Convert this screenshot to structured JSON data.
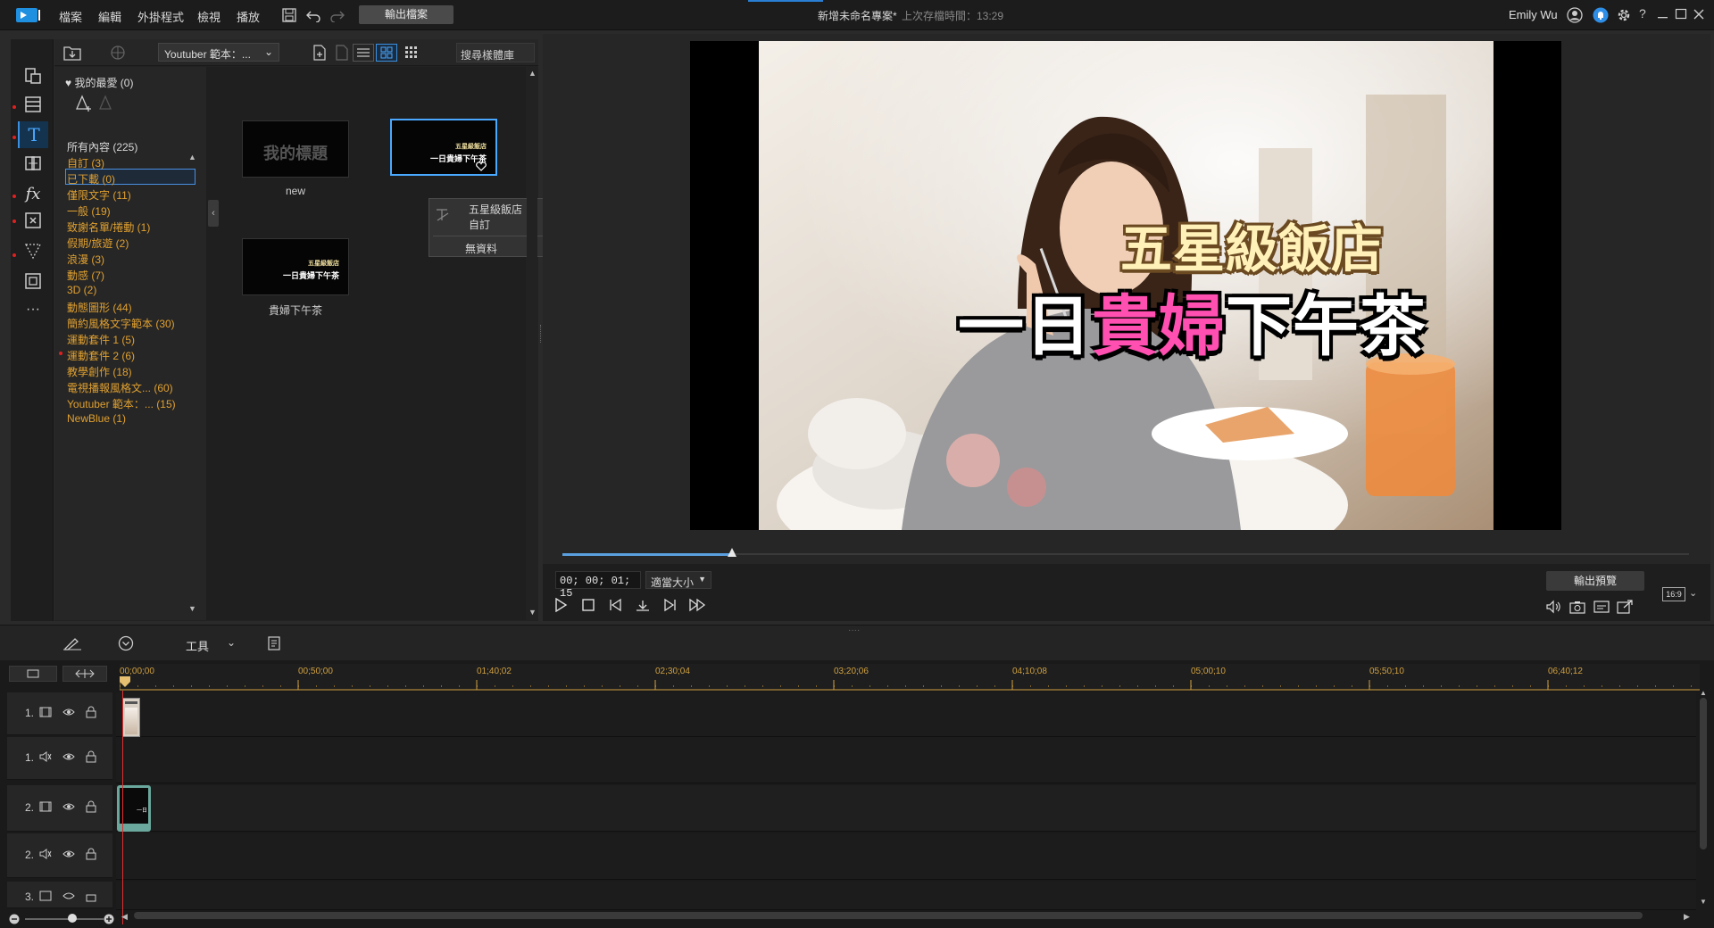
{
  "menu": {
    "items": [
      "檔案",
      "編輯",
      "外掛程式",
      "檢視",
      "播放"
    ],
    "export_label": "輸出檔案"
  },
  "window": {
    "title": "新增未命名專案*",
    "saved_note": "上次存檔時間：13:29",
    "user": "Emily Wu"
  },
  "library": {
    "category_select": "Youtuber 範本：...",
    "search_placeholder": "搜尋樣體庫",
    "favorites": "我的最愛 (0)",
    "tree": [
      "所有內容 (225)",
      "自訂 (3)",
      "已下載 (0)",
      "僅限文字 (11)",
      "一般 (19)",
      "致謝名單/捲動 (1)",
      "假期/旅遊 (2)",
      "浪漫 (3)",
      "動感 (7)",
      "3D (2)",
      "動態圖形 (44)",
      "簡約風格文字範本 (30)",
      "運動套件 1 (5)",
      "運動套件 2 (6)",
      "教學創作 (18)",
      "電視播報風格文... (60)",
      "Youtuber 範本：... (15)",
      "NewBlue (1)"
    ],
    "thumbs": [
      {
        "label": "new",
        "text": "我的標題"
      },
      {
        "label": "五星級飯店",
        "line1": "五星級飯店",
        "line2": "一日貴婦下午茶"
      },
      {
        "label": "貴婦下午茶",
        "line1": "五星級飯店",
        "line2": "一日貴婦下午茶"
      }
    ],
    "tooltip": {
      "line1": "五星級飯店",
      "line2": "自訂",
      "line3": "無資料"
    }
  },
  "preview": {
    "overlay_line1": "五星級飯店",
    "overlay_line2_a": "一日",
    "overlay_line2_b": "貴婦",
    "overlay_line2_c": "下午茶",
    "timecode": "00; 00; 01; 15",
    "zoom": "適當大小",
    "export_preview": "輸出預覽",
    "aspect": "16:9",
    "progress": 0.15
  },
  "timeline": {
    "tools_label": "工具",
    "ruler": [
      "00;00;00",
      "00;50;00",
      "01;40;02",
      "02;30;04",
      "03;20;06",
      "04;10;08",
      "05;00;10",
      "05;50;10",
      "06;40;12"
    ],
    "tracks": [
      "1.",
      "1.",
      "2.",
      "2.",
      "3."
    ],
    "clip_label": "一日"
  },
  "colors": {
    "accent": "#4a90e2",
    "tree_text": "#e0a030",
    "pink": "#ff4fb0",
    "cream": "#fff1b8",
    "playhead": "#e03030"
  }
}
